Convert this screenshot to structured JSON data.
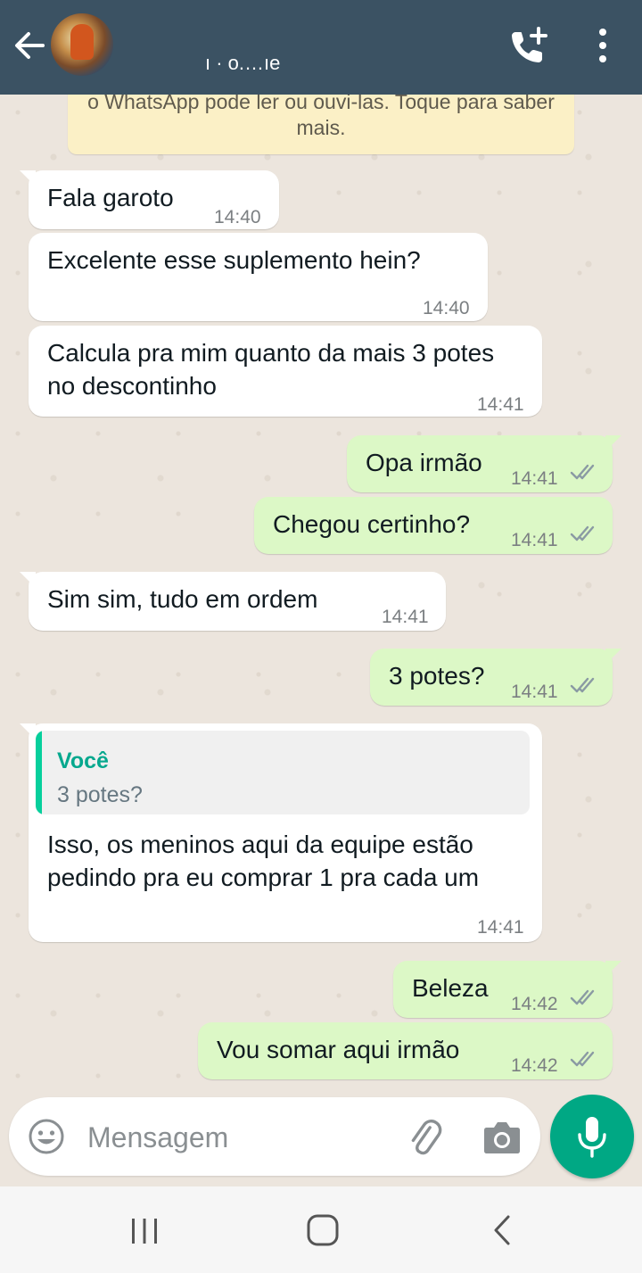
{
  "header": {
    "contact_name": "ı · o.…ıe",
    "bg_color": "#3b5263"
  },
  "notice": {
    "text": "o WhatsApp pode ler ou ouvi-las. Toque para saber mais."
  },
  "messages": [
    {
      "dir": "in",
      "text": "Fala garoto",
      "time": "14:40"
    },
    {
      "dir": "in",
      "text": "Excelente esse suplemento hein?",
      "time": "14:40"
    },
    {
      "dir": "in",
      "text": "Calcula pra mim quanto da mais 3 potes no descontinho",
      "time": "14:41"
    },
    {
      "dir": "out",
      "text": "Opa irmão",
      "time": "14:41"
    },
    {
      "dir": "out",
      "text": "Chegou certinho?",
      "time": "14:41"
    },
    {
      "dir": "in",
      "text": "Sim sim, tudo em ordem",
      "time": "14:41"
    },
    {
      "dir": "out",
      "text": "3 potes?",
      "time": "14:41"
    },
    {
      "dir": "in",
      "text": "Isso, os meninos aqui da equipe estão pedindo pra eu comprar 1 pra cada um",
      "time": "14:41",
      "quote": {
        "author": "Você",
        "text": "3 potes?"
      }
    },
    {
      "dir": "out",
      "text": "Beleza",
      "time": "14:42"
    },
    {
      "dir": "out",
      "text": "Vou somar aqui irmão",
      "time": "14:42"
    }
  ],
  "input": {
    "placeholder": "Mensagem"
  },
  "colors": {
    "incoming": "#ffffff",
    "outgoing": "#dcf8c6",
    "accent": "#00a884",
    "tick": "#8a9aa3"
  },
  "icons": [
    "back-arrow-icon",
    "avatar",
    "add-call-icon",
    "more-vert-icon",
    "emoji-icon",
    "paperclip-icon",
    "camera-icon",
    "mic-icon",
    "recents-icon",
    "home-icon",
    "nav-back-icon",
    "double-check-icon"
  ]
}
